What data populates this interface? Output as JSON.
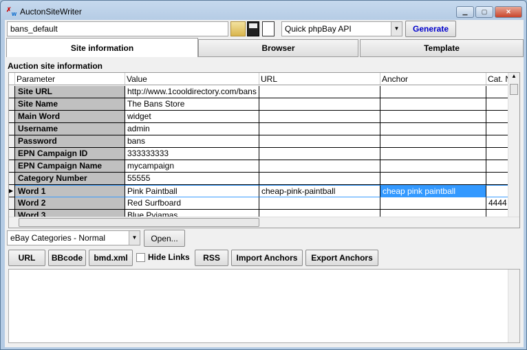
{
  "window": {
    "title": "AuctonSiteWriter"
  },
  "toolbar": {
    "profile_value": "bans_default",
    "api_select": "Quick phpBay API",
    "generate": "Generate"
  },
  "tabs": [
    {
      "label": "Site information",
      "active": true
    },
    {
      "label": "Browser"
    },
    {
      "label": "Template"
    }
  ],
  "section_title": "Auction site information",
  "table": {
    "columns": [
      "Parameter",
      "Value",
      "URL",
      "Anchor",
      "Cat. N"
    ],
    "rows": [
      [
        "Site URL",
        "http://www.1cooldirectory.com/bans",
        "",
        "",
        ""
      ],
      [
        "Site Name",
        "The Bans Store",
        "",
        "",
        ""
      ],
      [
        "Main Word",
        "widget",
        "",
        "",
        ""
      ],
      [
        "Username",
        "admin",
        "",
        "",
        ""
      ],
      [
        "Password",
        "bans",
        "",
        "",
        ""
      ],
      [
        "EPN Campaign ID",
        "333333333",
        "",
        "",
        ""
      ],
      [
        "EPN Campaign Name",
        "mycampaign",
        "",
        "",
        ""
      ],
      [
        "Category Number",
        "55555",
        "",
        "",
        ""
      ],
      [
        "Word   1",
        "Pink Paintball",
        "cheap-pink-paintball",
        "cheap pink paintball",
        ""
      ],
      [
        "Word   2",
        "Red Surfboard",
        "",
        "",
        "4444"
      ],
      [
        "Word   3",
        "Blue Pyjamas",
        "",
        "",
        ""
      ]
    ],
    "selected_row": 8
  },
  "categories": {
    "select": "eBay Categories - Normal",
    "open": "Open..."
  },
  "actions": {
    "url": "URL",
    "bbcode": "BBcode",
    "bmd": "bmd.xml",
    "hide_links": "Hide Links",
    "rss": "RSS",
    "import": "Import Anchors",
    "export": "Export Anchors"
  },
  "colors": {
    "selection": "#3399ff",
    "param_bg": "#c0c0c0",
    "generate_text": "#0000cc"
  }
}
